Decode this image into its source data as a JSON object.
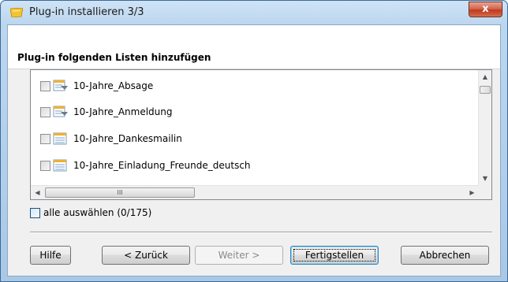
{
  "window": {
    "title": "Plug-in installieren 3/3",
    "close_glyph": "x"
  },
  "section_title": "Plug-in folgenden Listen hinzufügen",
  "list": {
    "items": [
      {
        "label": "10-Jahre_Absage",
        "icon": "filter-list-icon",
        "checked": false
      },
      {
        "label": "10-Jahre_Anmeldung",
        "icon": "filter-list-icon",
        "checked": false
      },
      {
        "label": "10-Jahre_Dankesmailin",
        "icon": "list-icon",
        "checked": false
      },
      {
        "label": "10-Jahre_Einladung_Freunde_deutsch",
        "icon": "list-icon",
        "checked": false
      }
    ],
    "scroll_grip": "III"
  },
  "select_all": {
    "label": "alle auswählen (0/175)",
    "checked": false
  },
  "buttons": {
    "help": "Hilfe",
    "back": "< Zurück",
    "next": "Weiter >",
    "finish": "Fertigstellen",
    "cancel": "Abbrechen"
  },
  "colors": {
    "title_bar": "#bcd6ef",
    "close_button": "#c1391d",
    "default_button_border": "#3c7fb1"
  }
}
